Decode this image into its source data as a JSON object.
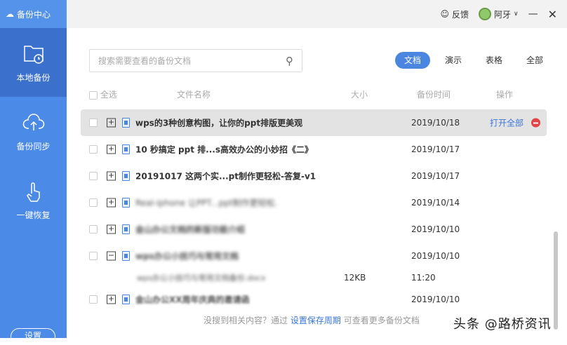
{
  "sidebar": {
    "brand": "备份中心",
    "items": [
      {
        "label": "本地备份"
      },
      {
        "label": "备份同步"
      },
      {
        "label": "一键恢复"
      }
    ],
    "settings": "设置"
  },
  "topbar": {
    "feedback": "反馈",
    "user": "阿牙"
  },
  "search": {
    "placeholder": "搜索需要查看的备份文档"
  },
  "tabs": [
    {
      "label": "文档"
    },
    {
      "label": "演示"
    },
    {
      "label": "表格"
    },
    {
      "label": "全部"
    }
  ],
  "columns": {
    "select_all": "全选",
    "name": "文件名称",
    "size": "大小",
    "time": "备份时间",
    "action": "操作"
  },
  "rows": [
    {
      "name": "wps的3种创意构图，让你的ppt排版更美观",
      "date": "2019/10/18",
      "action": "打开全部"
    },
    {
      "name": "10 秒搞定 ppt 排...s高效办公的小妙招《二》",
      "date": "2019/10/17"
    },
    {
      "name": "20191017 这两个实...pt制作更轻松-答复-v1",
      "date": "2019/10/17"
    },
    {
      "name": "Real-iphone 让PPT...ppt制作更轻松.",
      "date": "2019/10/14"
    },
    {
      "name": "金山办公文档的新版功能介绍",
      "date": "2019/10/10"
    },
    {
      "name": "wps办公小技巧与常用文档",
      "date": "2019/10/10",
      "child": {
        "name": "wps办公小技巧与常用文档备份.docx",
        "size": "12KB",
        "time": "11:20"
      }
    },
    {
      "name": "金山办公XX周年庆典的邀请函",
      "date": "2019/10/10"
    }
  ],
  "footer": {
    "prefix": "没搜到相关内容？通过",
    "link": "设置保存周期",
    "suffix": "可查看更多备份文档"
  },
  "watermark": "头条 @路桥资讯"
}
